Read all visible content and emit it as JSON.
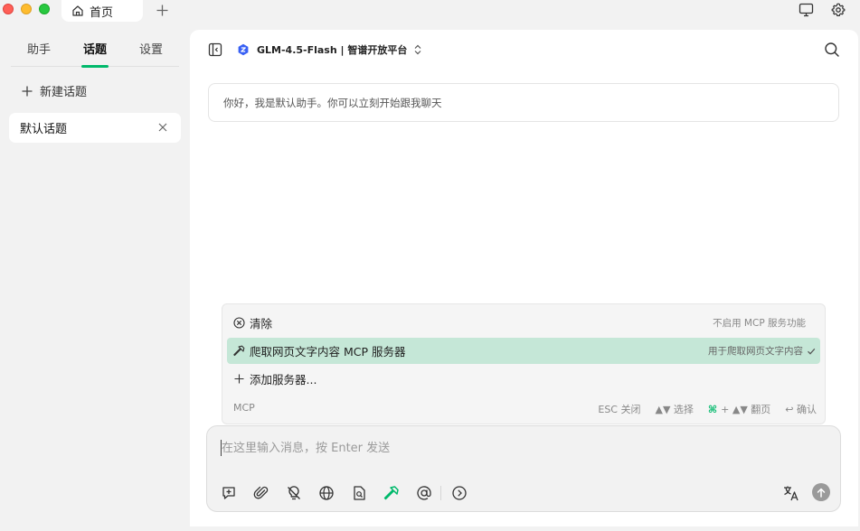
{
  "window": {
    "tab_home_label": "首页"
  },
  "sidebar": {
    "tabs": [
      {
        "label": "助手"
      },
      {
        "label": "话题"
      },
      {
        "label": "设置"
      }
    ],
    "active_tab": "话题",
    "new_topic_label": "新建话题",
    "topics": [
      {
        "label": "默认话题"
      }
    ]
  },
  "header": {
    "model_label": "GLM-4.5-Flash | 智谱开放平台"
  },
  "chat": {
    "greeting": "你好，我是默认助手。你可以立刻开始跟我聊天"
  },
  "mcp_popup": {
    "items": [
      {
        "label": "清除",
        "description": "不启用 MCP 服务功能",
        "icon": "clear-circle-icon"
      },
      {
        "label": "爬取网页文字内容 MCP 服务器",
        "description": "用于爬取网页文字内容",
        "icon": "hammer-icon",
        "selected": true
      },
      {
        "label": "添加服务器...",
        "description": "",
        "icon": "plus-icon"
      }
    ],
    "footer_label": "MCP",
    "hints": {
      "esc": "ESC 关闭",
      "select": "▲▼ 选择",
      "page_key": "⌘",
      "page_rest": "+ ▲▼ 翻页",
      "confirm": "↩ 确认"
    }
  },
  "input": {
    "placeholder": "在这里输入消息，按 Enter 发送",
    "value": ""
  },
  "colors": {
    "accent": "#00b96b",
    "selected_row": "#c5e7d7"
  }
}
